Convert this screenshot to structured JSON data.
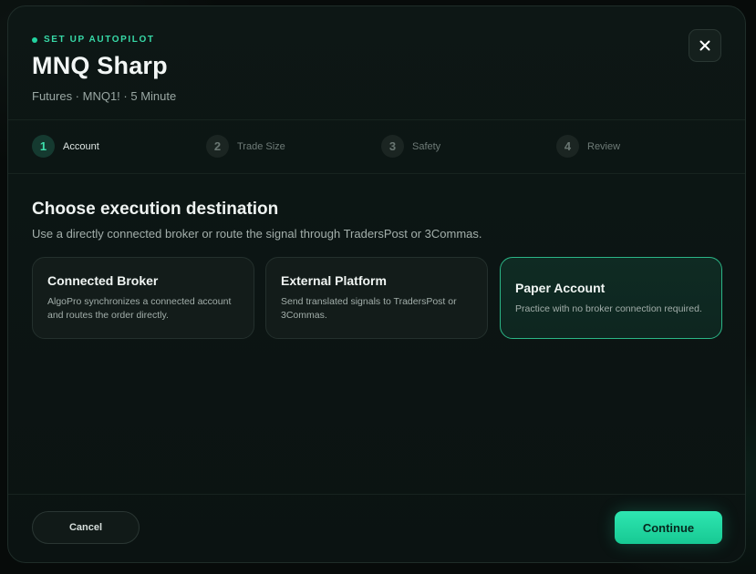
{
  "header": {
    "kicker": "SET UP AUTOPILOT",
    "title": "MNQ Sharp",
    "subtitle": "Futures · MNQ1! · 5 Minute",
    "close_icon": "close-icon"
  },
  "steps": [
    {
      "number": "1",
      "label": "Account",
      "active": true
    },
    {
      "number": "2",
      "label": "Trade Size",
      "active": false
    },
    {
      "number": "3",
      "label": "Safety",
      "active": false
    },
    {
      "number": "4",
      "label": "Review",
      "active": false
    }
  ],
  "section": {
    "title": "Choose execution destination",
    "description": "Use a directly connected broker or route the signal through TradersPost or 3Commas."
  },
  "options": [
    {
      "title": "Connected Broker",
      "description": "AlgoPro synchronizes a connected account and routes the order directly.",
      "selected": false
    },
    {
      "title": "External Platform",
      "description": "Send translated signals to TradersPost or 3Commas.",
      "selected": false
    },
    {
      "title": "Paper Account",
      "description": "Practice with no broker connection required.",
      "selected": true
    }
  ],
  "footer": {
    "cancel_label": "Cancel",
    "continue_label": "Continue"
  },
  "colors": {
    "accent": "#22d3a0",
    "background": "#0b1312",
    "selected_border": "#2bb687"
  }
}
